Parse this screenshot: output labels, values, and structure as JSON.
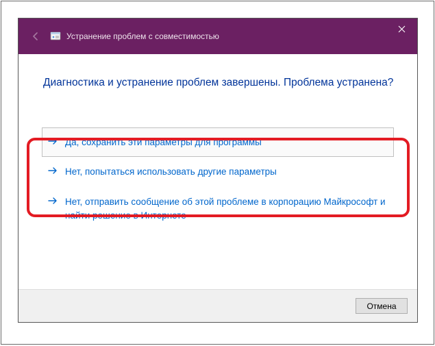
{
  "titlebar": {
    "title": "Устранение проблем с совместимостью"
  },
  "heading": "Диагностика и устранение проблем завершены. Проблема устранена?",
  "options": {
    "yes_save": "Да, сохранить эти параметры для программы",
    "no_try_other": "Нет, попытаться использовать другие параметры",
    "no_report": "Нет, отправить сообщение об этой проблеме в корпорацию Майкрософт и найти решение в Интернете"
  },
  "footer": {
    "cancel": "Отмена"
  }
}
